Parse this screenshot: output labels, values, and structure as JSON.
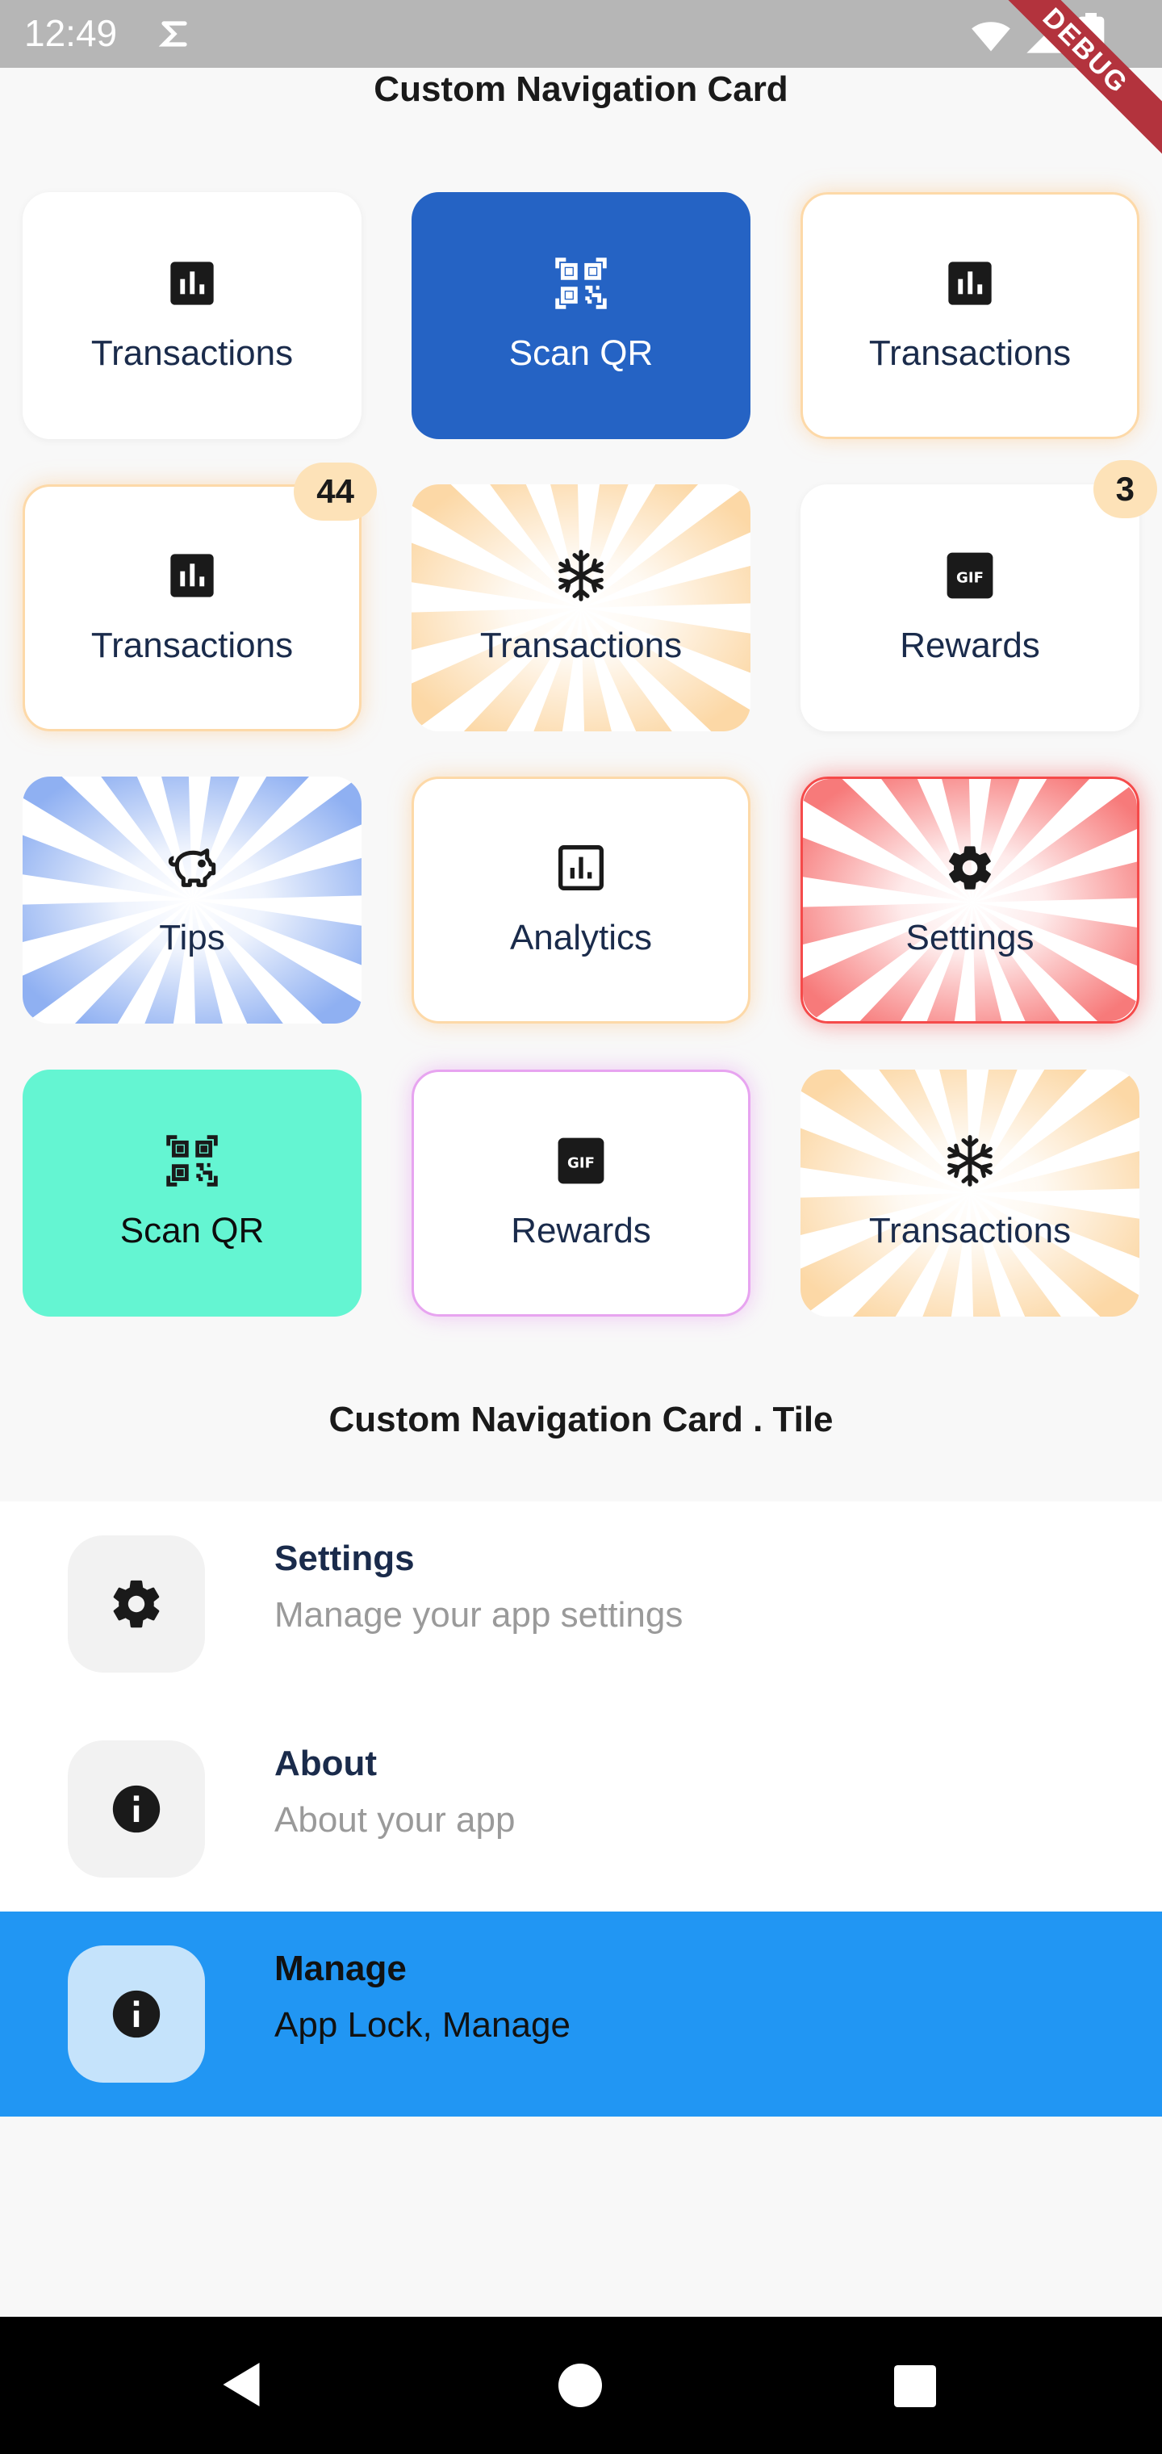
{
  "status": {
    "time": "12:49",
    "debug": "DEBUG"
  },
  "page_title": "Custom Navigation Card",
  "tile_section_title": "Custom Navigation Card . Tile",
  "cards": [
    {
      "label": "Transactions",
      "icon": "bar-chart-icon",
      "style": "plain"
    },
    {
      "label": "Scan QR",
      "icon": "qr-code-icon",
      "style": "filled-blue"
    },
    {
      "label": "Transactions",
      "icon": "bar-chart-icon",
      "style": "orange-glow"
    },
    {
      "label": "Transactions",
      "icon": "bar-chart-icon",
      "style": "orange-glow",
      "badge": "44"
    },
    {
      "label": "Transactions",
      "icon": "snowflake-icon",
      "style": "orange-rays"
    },
    {
      "label": "Rewards",
      "icon": "gif-icon",
      "style": "plain",
      "badge": "3"
    },
    {
      "label": "Tips",
      "icon": "piggy-bank-icon",
      "style": "blue-rays"
    },
    {
      "label": "Analytics",
      "icon": "analytics-icon",
      "style": "orange-glow"
    },
    {
      "label": "Settings",
      "icon": "gear-icon",
      "style": "red-rays"
    },
    {
      "label": "Scan QR",
      "icon": "qr-code-icon",
      "style": "filled-mint"
    },
    {
      "label": "Rewards",
      "icon": "gif-icon",
      "style": "pink-glow"
    },
    {
      "label": "Transactions",
      "icon": "snowflake-icon",
      "style": "orange-rays"
    }
  ],
  "tiles": [
    {
      "title": "Settings",
      "subtitle": "Manage your app settings",
      "icon": "gear-icon",
      "selected": false
    },
    {
      "title": "About",
      "subtitle": "About your app",
      "icon": "info-icon",
      "selected": false
    },
    {
      "title": "Manage",
      "subtitle": "App Lock, Manage",
      "icon": "info-icon",
      "selected": true
    }
  ],
  "colors": {
    "blue_card": "#2563c4",
    "mint_card": "#64f5d2",
    "selected_tile": "#2196f3",
    "orange_glow": "#fdd9a8",
    "red_glow": "#f54a4a",
    "pink_glow": "#e7a4f0",
    "text_dark": "#1a2b4b"
  },
  "gif_text": "GIF"
}
